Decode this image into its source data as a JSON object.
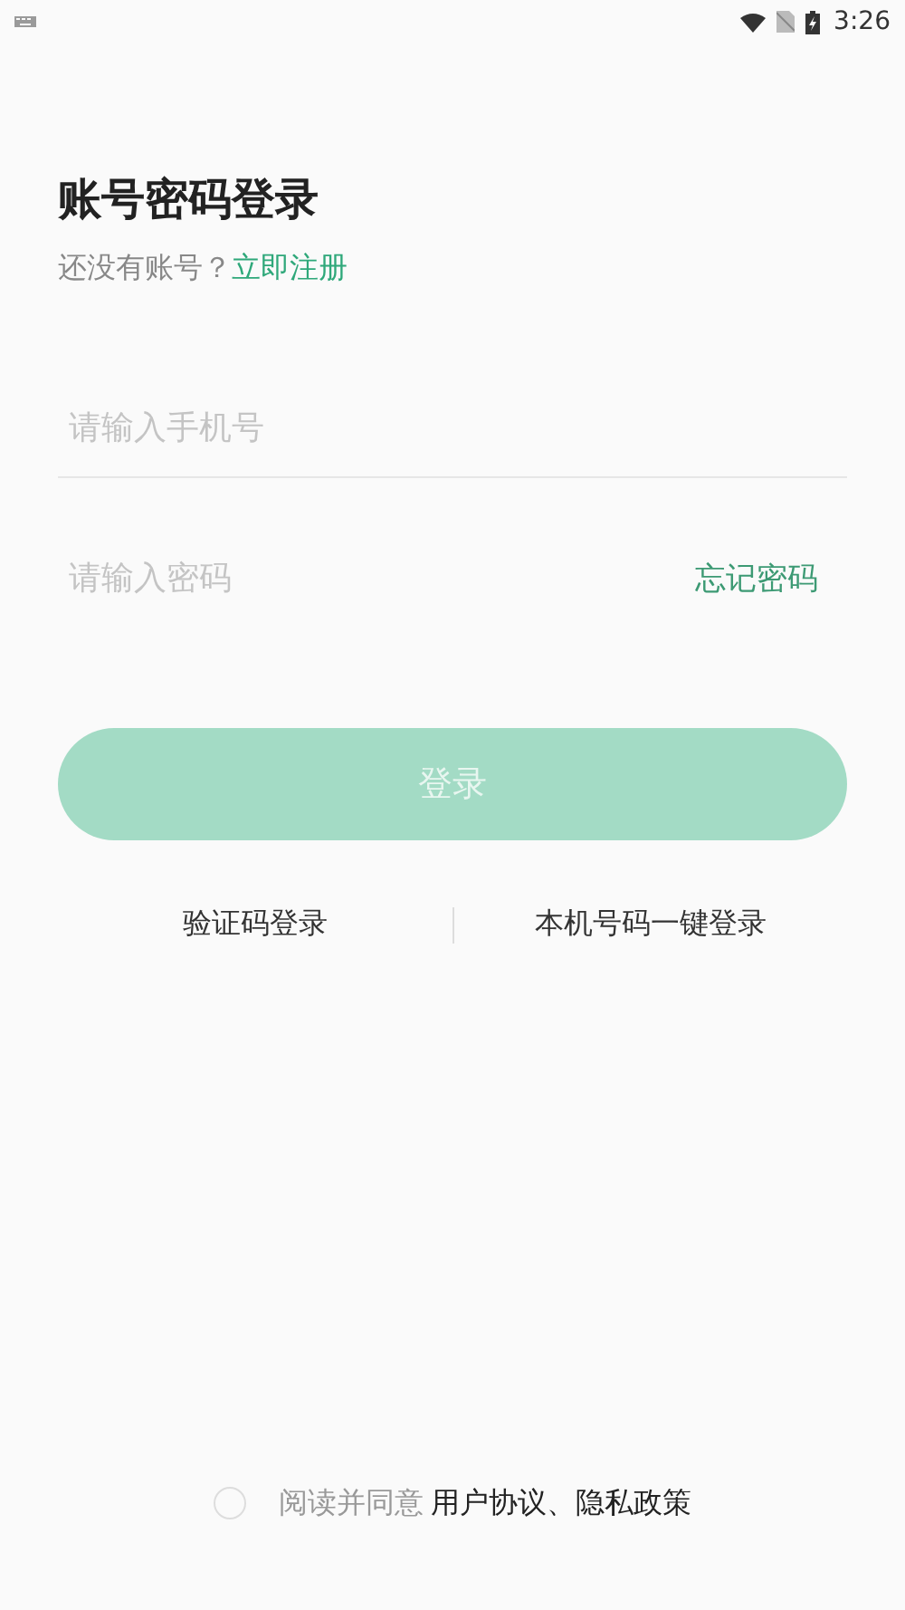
{
  "status_bar": {
    "time": "3:26"
  },
  "title": "账号密码登录",
  "register": {
    "prompt": "还没有账号？",
    "link": "立即注册"
  },
  "phone_field": {
    "placeholder": "请输入手机号"
  },
  "password_field": {
    "placeholder": "请输入密码",
    "forgot": "忘记密码"
  },
  "login_button": {
    "label": "登录",
    "disabled": true
  },
  "alt_logins": [
    "验证码登录",
    "本机号码一键登录"
  ],
  "agreement": {
    "checked": false,
    "text": "阅读并同意",
    "links": "用户协议、隐私政策"
  }
}
